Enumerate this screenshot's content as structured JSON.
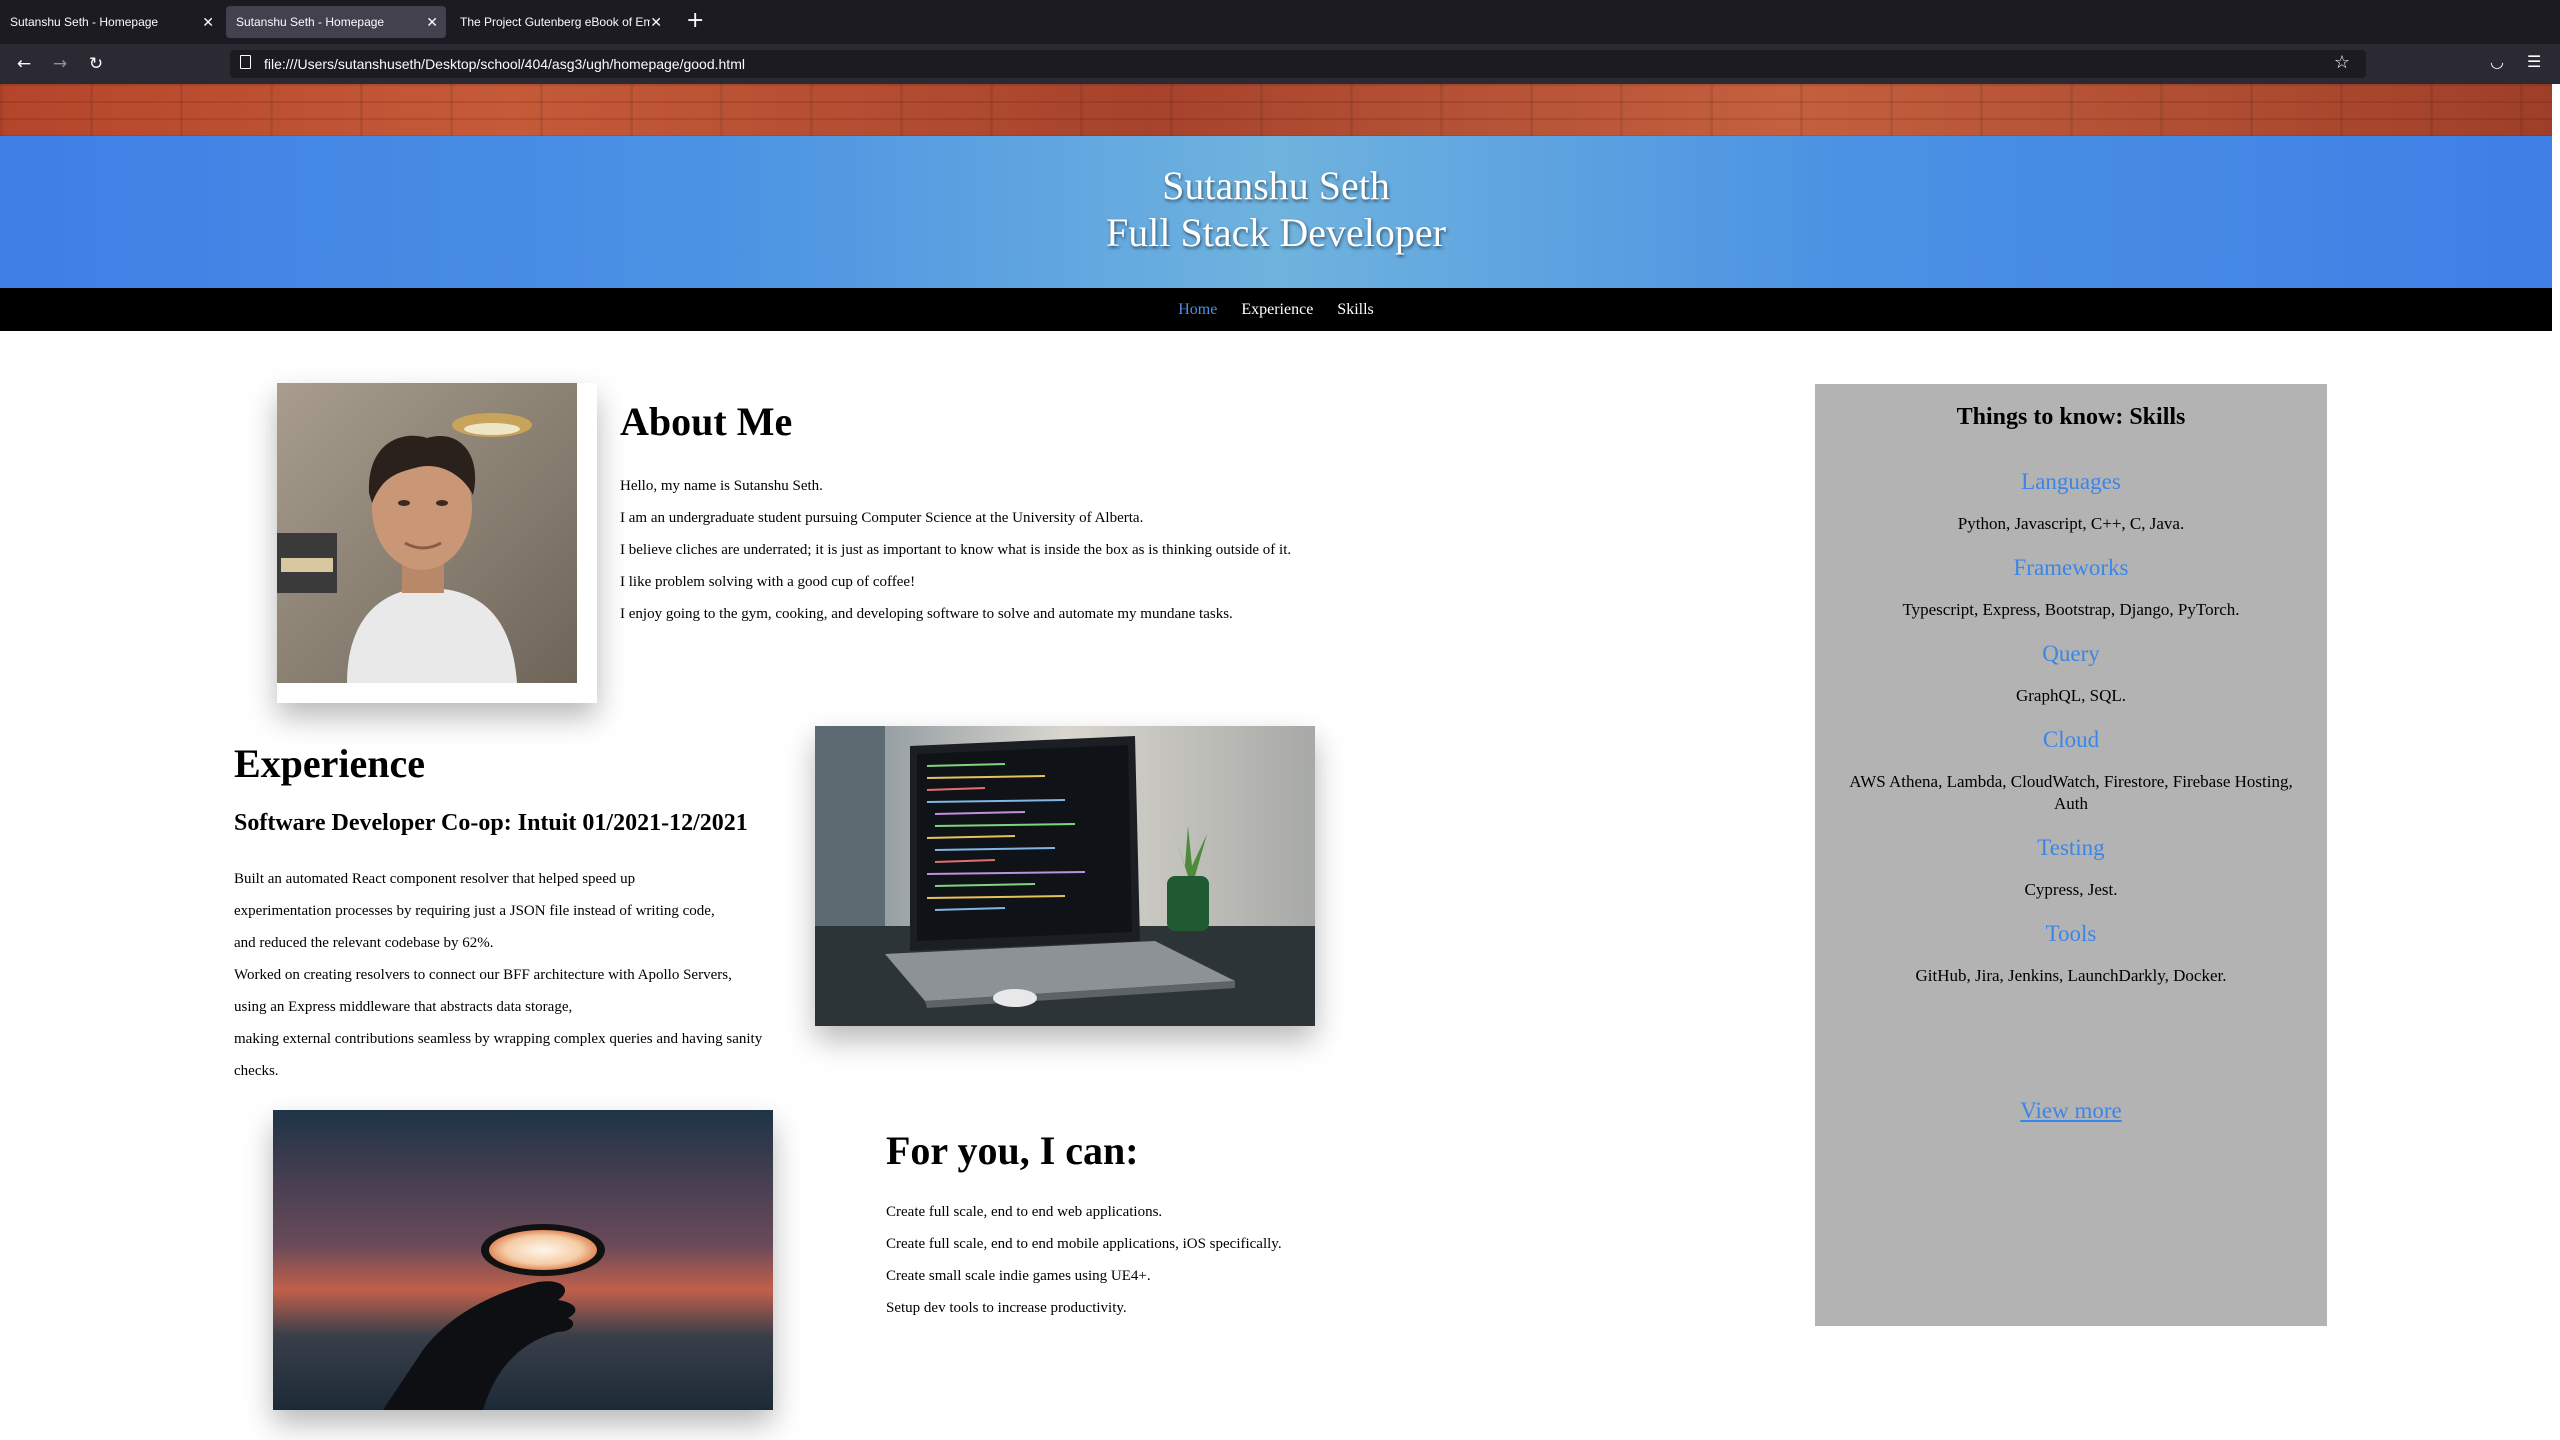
{
  "browser": {
    "tabs": [
      {
        "label": "Sutanshu Seth - Homepage",
        "active": false
      },
      {
        "label": "Sutanshu Seth - Homepage",
        "active": true
      },
      {
        "label": "The Project Gutenberg eBook of Em",
        "active": false
      }
    ],
    "url": "file:///Users/sutanshuseth/Desktop/school/404/asg3/ugh/homepage/good.html"
  },
  "header": {
    "name": "Sutanshu Seth",
    "role": "Full Stack Developer"
  },
  "nav": {
    "items": [
      {
        "label": "Home",
        "active": true
      },
      {
        "label": "Experience",
        "active": false
      },
      {
        "label": "Skills",
        "active": false
      }
    ]
  },
  "about": {
    "title": "About Me",
    "lines": [
      "Hello, my name is Sutanshu Seth.",
      "I am an undergraduate student pursuing Computer Science at the University of Alberta.",
      "I believe cliches are underrated; it is just as important to know what is inside the box as is thinking outside of it.",
      "I like problem solving with a good cup of coffee!",
      "I enjoy going to the gym, cooking, and developing software to solve and automate my mundane tasks."
    ]
  },
  "experience": {
    "title": "Experience",
    "job_title": "Software Developer Co-op: Intuit 01/2021-12/2021",
    "lines": [
      "Built an automated React component resolver that helped speed up",
      "experimentation processes by requiring just a JSON file instead of writing code,",
      "and reduced the relevant codebase by 62%.",
      "Worked on creating resolvers to connect our BFF architecture with Apollo Servers,",
      "using an Express middleware that abstracts data storage,",
      "making external contributions seamless by wrapping complex queries and having sanity",
      "checks."
    ]
  },
  "offer": {
    "title": "For you, I can:",
    "lines": [
      "Create full scale, end to end web applications.",
      "Create full scale, end to end mobile applications, iOS specifically.",
      "Create small scale indie games using UE4+.",
      "Setup dev tools to increase productivity."
    ]
  },
  "skills": {
    "title": "Things to know: Skills",
    "categories": [
      {
        "name": "Languages",
        "items": "Python, Javascript, C++, C, Java."
      },
      {
        "name": "Frameworks",
        "items": "Typescript, Express, Bootstrap, Django, PyTorch."
      },
      {
        "name": "Query",
        "items": "GraphQL, SQL."
      },
      {
        "name": "Cloud",
        "items": "AWS Athena, Lambda, CloudWatch, Firestore, Firebase Hosting, Auth"
      },
      {
        "name": "Testing",
        "items": "Cypress, Jest."
      },
      {
        "name": "Tools",
        "items": "GitHub, Jira, Jenkins, LaunchDarkly, Docker."
      }
    ],
    "view_more": "View more"
  },
  "colors": {
    "link_blue": "#3a86e8",
    "header_blue": "#3f7fe6",
    "sidebar_gray": "#b3b3b3",
    "nav_black": "#000000"
  }
}
